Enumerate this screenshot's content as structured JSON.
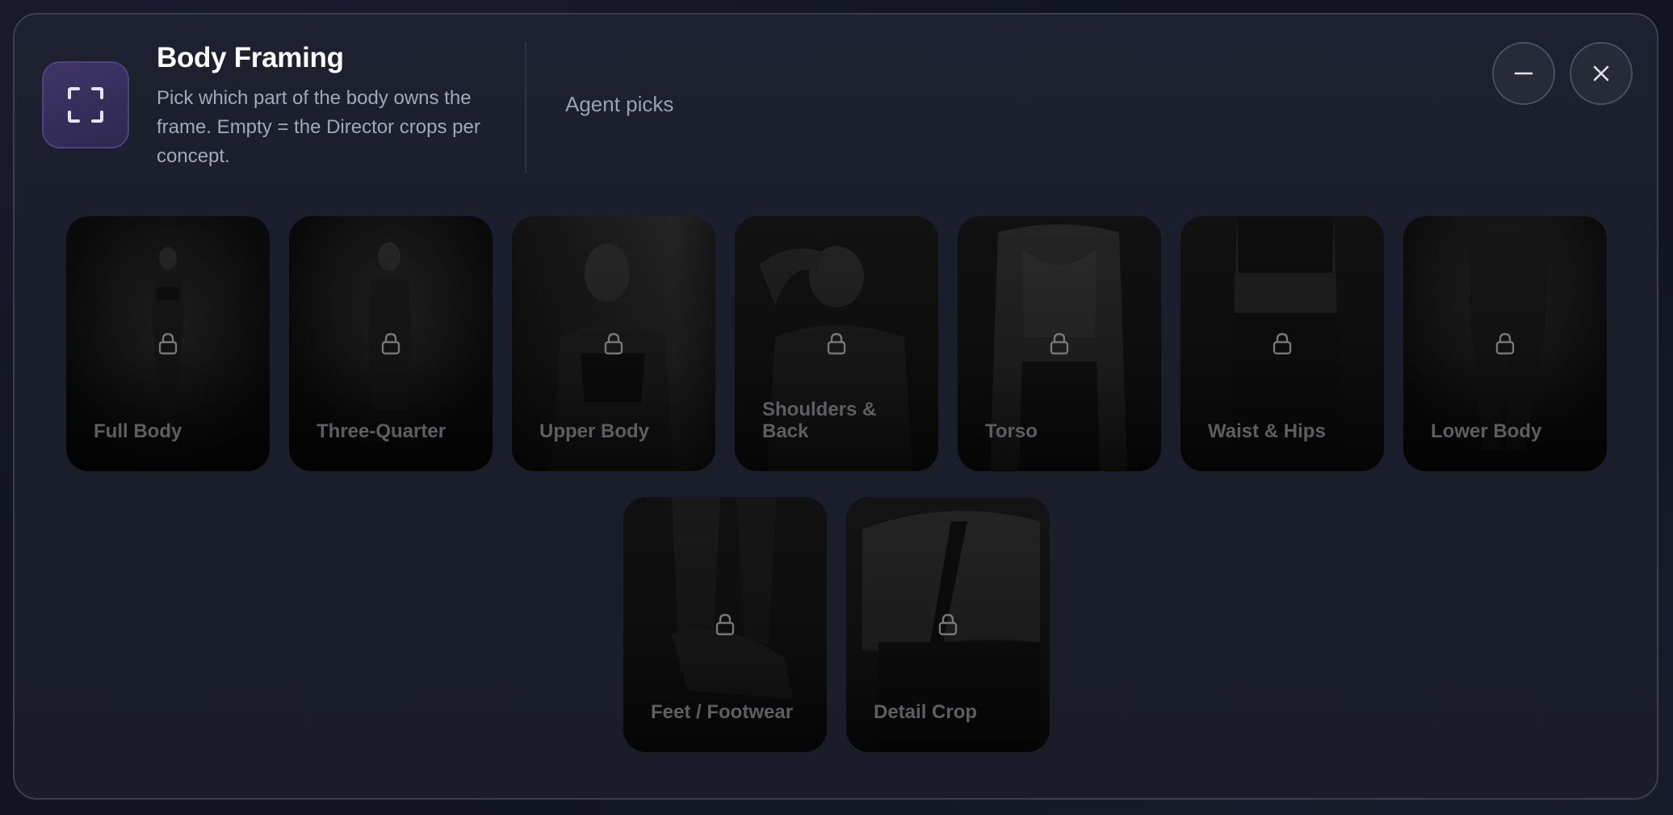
{
  "header": {
    "title": "Body Framing",
    "subtitle": "Pick which part of the body owns the frame. Empty = the Director crops per concept.",
    "agent_picks": "Agent picks",
    "icon": "frame-corners-icon"
  },
  "controls": {
    "minimize_icon": "minus-icon",
    "close_icon": "close-icon"
  },
  "cards": [
    {
      "label": "Full Body",
      "locked": true
    },
    {
      "label": "Three-Quarter",
      "locked": true
    },
    {
      "label": "Upper Body",
      "locked": true
    },
    {
      "label": "Shoulders & Back",
      "locked": true
    },
    {
      "label": "Torso",
      "locked": true
    },
    {
      "label": "Waist & Hips",
      "locked": true
    },
    {
      "label": "Lower Body",
      "locked": true
    },
    {
      "label": "Feet / Footwear",
      "locked": true
    },
    {
      "label": "Detail Crop",
      "locked": true
    }
  ],
  "colors": {
    "accent": "#3e3566",
    "panel": "#1b1f2c",
    "card_label": "#5e5e62"
  }
}
